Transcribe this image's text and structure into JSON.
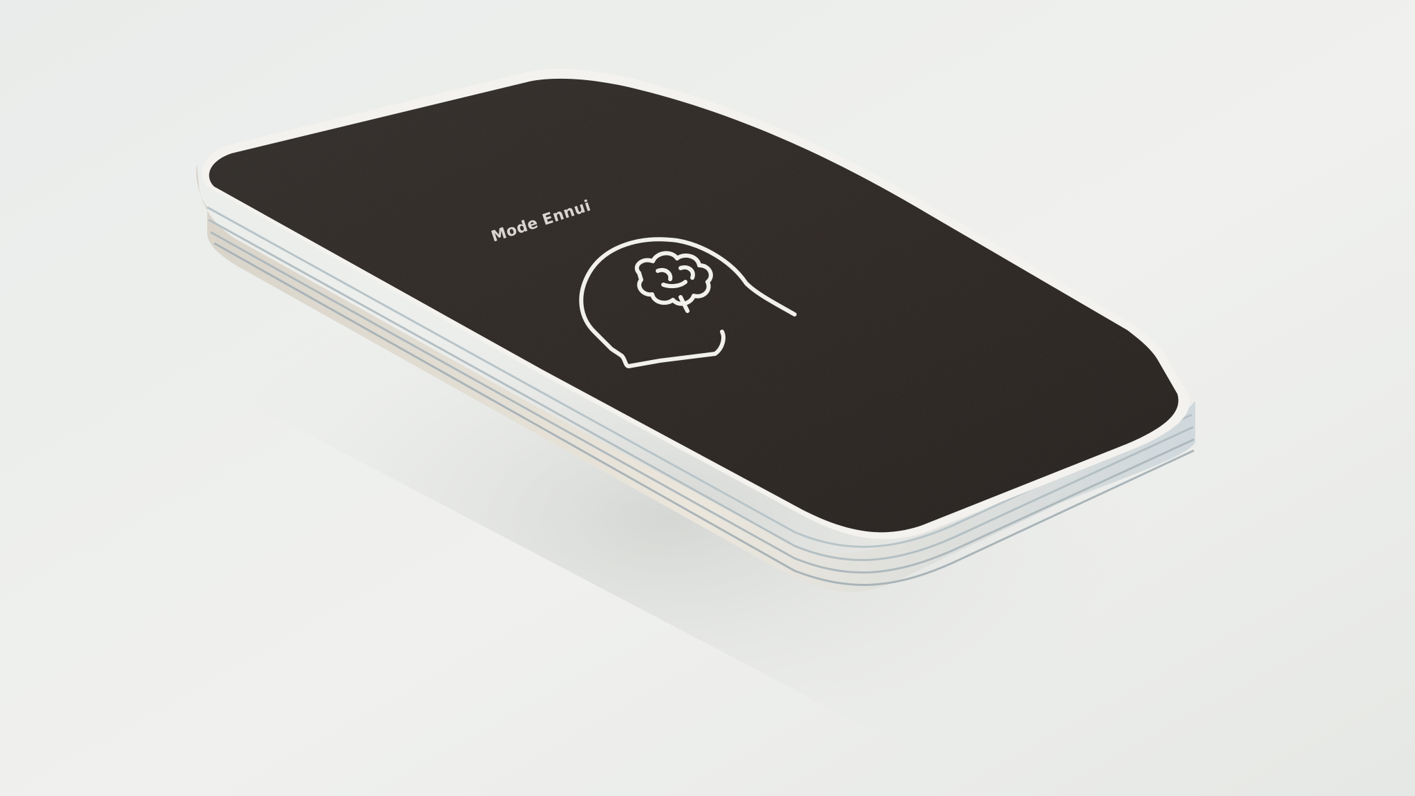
{
  "card": {
    "label": "Mode Ennui",
    "icon": "head-with-brain-icon"
  },
  "colors": {
    "background": "#eef0ee",
    "card_face": "#2a2522",
    "card_edge": "#e7e2d8",
    "icon_stroke": "#f2f0ea"
  }
}
